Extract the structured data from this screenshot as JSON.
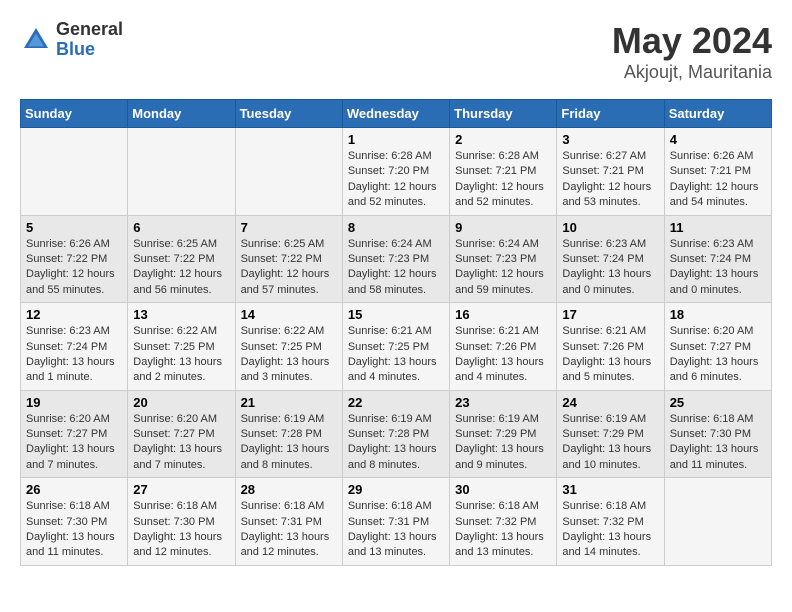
{
  "header": {
    "logo_general": "General",
    "logo_blue": "Blue",
    "month_title": "May 2024",
    "location": "Akjoujt, Mauritania"
  },
  "days_of_week": [
    "Sunday",
    "Monday",
    "Tuesday",
    "Wednesday",
    "Thursday",
    "Friday",
    "Saturday"
  ],
  "weeks": [
    [
      {
        "day": "",
        "info": ""
      },
      {
        "day": "",
        "info": ""
      },
      {
        "day": "",
        "info": ""
      },
      {
        "day": "1",
        "info": "Sunrise: 6:28 AM\nSunset: 7:20 PM\nDaylight: 12 hours and 52 minutes."
      },
      {
        "day": "2",
        "info": "Sunrise: 6:28 AM\nSunset: 7:21 PM\nDaylight: 12 hours and 52 minutes."
      },
      {
        "day": "3",
        "info": "Sunrise: 6:27 AM\nSunset: 7:21 PM\nDaylight: 12 hours and 53 minutes."
      },
      {
        "day": "4",
        "info": "Sunrise: 6:26 AM\nSunset: 7:21 PM\nDaylight: 12 hours and 54 minutes."
      }
    ],
    [
      {
        "day": "5",
        "info": "Sunrise: 6:26 AM\nSunset: 7:22 PM\nDaylight: 12 hours and 55 minutes."
      },
      {
        "day": "6",
        "info": "Sunrise: 6:25 AM\nSunset: 7:22 PM\nDaylight: 12 hours and 56 minutes."
      },
      {
        "day": "7",
        "info": "Sunrise: 6:25 AM\nSunset: 7:22 PM\nDaylight: 12 hours and 57 minutes."
      },
      {
        "day": "8",
        "info": "Sunrise: 6:24 AM\nSunset: 7:23 PM\nDaylight: 12 hours and 58 minutes."
      },
      {
        "day": "9",
        "info": "Sunrise: 6:24 AM\nSunset: 7:23 PM\nDaylight: 12 hours and 59 minutes."
      },
      {
        "day": "10",
        "info": "Sunrise: 6:23 AM\nSunset: 7:24 PM\nDaylight: 13 hours and 0 minutes."
      },
      {
        "day": "11",
        "info": "Sunrise: 6:23 AM\nSunset: 7:24 PM\nDaylight: 13 hours and 0 minutes."
      }
    ],
    [
      {
        "day": "12",
        "info": "Sunrise: 6:23 AM\nSunset: 7:24 PM\nDaylight: 13 hours and 1 minute."
      },
      {
        "day": "13",
        "info": "Sunrise: 6:22 AM\nSunset: 7:25 PM\nDaylight: 13 hours and 2 minutes."
      },
      {
        "day": "14",
        "info": "Sunrise: 6:22 AM\nSunset: 7:25 PM\nDaylight: 13 hours and 3 minutes."
      },
      {
        "day": "15",
        "info": "Sunrise: 6:21 AM\nSunset: 7:25 PM\nDaylight: 13 hours and 4 minutes."
      },
      {
        "day": "16",
        "info": "Sunrise: 6:21 AM\nSunset: 7:26 PM\nDaylight: 13 hours and 4 minutes."
      },
      {
        "day": "17",
        "info": "Sunrise: 6:21 AM\nSunset: 7:26 PM\nDaylight: 13 hours and 5 minutes."
      },
      {
        "day": "18",
        "info": "Sunrise: 6:20 AM\nSunset: 7:27 PM\nDaylight: 13 hours and 6 minutes."
      }
    ],
    [
      {
        "day": "19",
        "info": "Sunrise: 6:20 AM\nSunset: 7:27 PM\nDaylight: 13 hours and 7 minutes."
      },
      {
        "day": "20",
        "info": "Sunrise: 6:20 AM\nSunset: 7:27 PM\nDaylight: 13 hours and 7 minutes."
      },
      {
        "day": "21",
        "info": "Sunrise: 6:19 AM\nSunset: 7:28 PM\nDaylight: 13 hours and 8 minutes."
      },
      {
        "day": "22",
        "info": "Sunrise: 6:19 AM\nSunset: 7:28 PM\nDaylight: 13 hours and 8 minutes."
      },
      {
        "day": "23",
        "info": "Sunrise: 6:19 AM\nSunset: 7:29 PM\nDaylight: 13 hours and 9 minutes."
      },
      {
        "day": "24",
        "info": "Sunrise: 6:19 AM\nSunset: 7:29 PM\nDaylight: 13 hours and 10 minutes."
      },
      {
        "day": "25",
        "info": "Sunrise: 6:18 AM\nSunset: 7:30 PM\nDaylight: 13 hours and 11 minutes."
      }
    ],
    [
      {
        "day": "26",
        "info": "Sunrise: 6:18 AM\nSunset: 7:30 PM\nDaylight: 13 hours and 11 minutes."
      },
      {
        "day": "27",
        "info": "Sunrise: 6:18 AM\nSunset: 7:30 PM\nDaylight: 13 hours and 12 minutes."
      },
      {
        "day": "28",
        "info": "Sunrise: 6:18 AM\nSunset: 7:31 PM\nDaylight: 13 hours and 12 minutes."
      },
      {
        "day": "29",
        "info": "Sunrise: 6:18 AM\nSunset: 7:31 PM\nDaylight: 13 hours and 13 minutes."
      },
      {
        "day": "30",
        "info": "Sunrise: 6:18 AM\nSunset: 7:32 PM\nDaylight: 13 hours and 13 minutes."
      },
      {
        "day": "31",
        "info": "Sunrise: 6:18 AM\nSunset: 7:32 PM\nDaylight: 13 hours and 14 minutes."
      },
      {
        "day": "",
        "info": ""
      }
    ]
  ]
}
